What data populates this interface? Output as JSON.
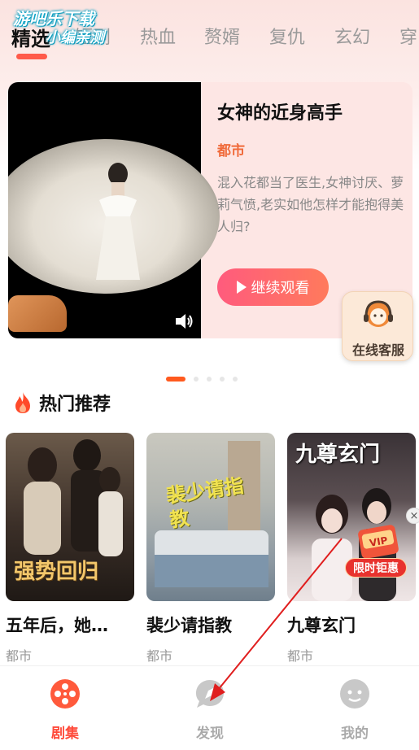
{
  "watermark": {
    "line1": "游吧乐下载",
    "line2": "小编亲测"
  },
  "tabs": [
    {
      "label": "精选",
      "active": true
    },
    {
      "label": "短剧"
    },
    {
      "label": "热血"
    },
    {
      "label": "赘婿"
    },
    {
      "label": "复仇"
    },
    {
      "label": "玄幻"
    },
    {
      "label": "穿"
    }
  ],
  "banner": {
    "title": "女神的近身高手",
    "genre": "都市",
    "description": "混入花都当了医生,女神讨厌、萝莉气愤,老实如他怎样才能抱得美人归?",
    "continue_label": "继续观看",
    "sound_icon": "speaker-icon"
  },
  "service": {
    "label": "在线客服",
    "icon": "headset-icon"
  },
  "carousel": {
    "count": 5,
    "active_index": 0
  },
  "hot": {
    "title": "热门推荐",
    "icon": "flame-icon",
    "items": [
      {
        "name": "五年后，她…",
        "genre": "都市",
        "poster_text": "强势回归"
      },
      {
        "name": "裴少请指教",
        "genre": "都市",
        "poster_text": "裴少请指教"
      },
      {
        "name": "九尊玄门",
        "genre": "都市",
        "poster_text": "九尊玄门"
      }
    ]
  },
  "promo": {
    "label": "限时钜惠",
    "badge": "VIP",
    "close": "×"
  },
  "bottom_nav": [
    {
      "label": "剧集",
      "icon": "film-reel-icon",
      "active": true
    },
    {
      "label": "发现",
      "icon": "discover-icon"
    },
    {
      "label": "我的",
      "icon": "profile-icon"
    }
  ],
  "colors": {
    "accent": "#ff4a3a",
    "genre": "#f06a3a",
    "button_start": "#ff5b7d",
    "button_end": "#ff7a5c"
  }
}
